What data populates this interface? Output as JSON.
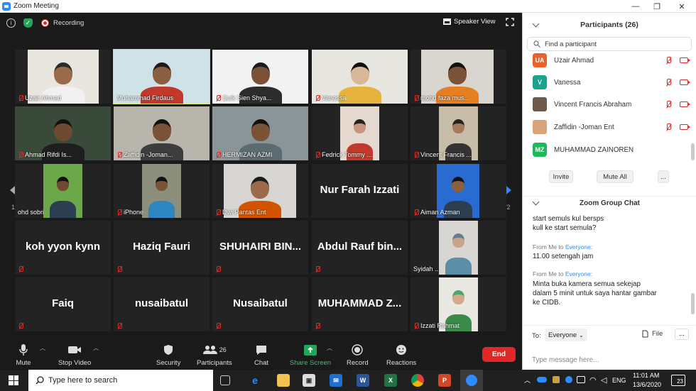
{
  "window": {
    "title": "Zoom Meeting",
    "min": "—",
    "max": "❐",
    "close": "✕"
  },
  "topbar": {
    "recording": "Recording",
    "speaker_view": "Speaker View"
  },
  "colors": {
    "accent": "#2d8cff",
    "end": "#e02828",
    "active_border": "#d6e26a"
  },
  "grid": {
    "page_left": "1/2",
    "page_right": "1/2",
    "tiles": [
      {
        "name": "Uzair Ahmad",
        "muted": true,
        "big": ""
      },
      {
        "name": "Muhammad Firdaus",
        "muted": false,
        "big": ""
      },
      {
        "name": "Quik Sien Shya...",
        "muted": true,
        "big": ""
      },
      {
        "name": "Vanessa",
        "muted": true,
        "big": ""
      },
      {
        "name": "mohd faza mus...",
        "muted": true,
        "big": ""
      },
      {
        "name": "Ahmad Rifdi Is...",
        "muted": true,
        "big": ""
      },
      {
        "name": "Zaffidin -Joman...",
        "muted": true,
        "big": ""
      },
      {
        "name": "HERMIZAN AZMI",
        "muted": true,
        "big": ""
      },
      {
        "name": "Fedrick Tommy ...",
        "muted": true,
        "big": ""
      },
      {
        "name": "Vincent Francis ...",
        "muted": true,
        "big": ""
      },
      {
        "name": "ohd sobri",
        "muted": false,
        "big": ""
      },
      {
        "name": "iPhone",
        "muted": true,
        "big": ""
      },
      {
        "name": "Dwi Pantas Ent",
        "muted": true,
        "big": ""
      },
      {
        "name": "",
        "muted": false,
        "big": "Nur Farah Izzati"
      },
      {
        "name": "Aiman Azman",
        "muted": true,
        "big": ""
      },
      {
        "name": "",
        "muted": true,
        "big": "koh yyon kynn"
      },
      {
        "name": "",
        "muted": true,
        "big": "Haziq Fauri"
      },
      {
        "name": "",
        "muted": true,
        "big": "SHUHAIRI BIN..."
      },
      {
        "name": "",
        "muted": true,
        "big": "Abdul Rauf bin..."
      },
      {
        "name": "Syidah ...",
        "muted": false,
        "big": ""
      },
      {
        "name": "",
        "muted": true,
        "big": "Faiq"
      },
      {
        "name": "",
        "muted": true,
        "big": "nusaibatul"
      },
      {
        "name": "",
        "muted": true,
        "big": "Nusaibatul"
      },
      {
        "name": "",
        "muted": true,
        "big": "MUHAMMAD Z..."
      },
      {
        "name": "Izzati Rahmat",
        "muted": true,
        "big": ""
      }
    ]
  },
  "toolbar": {
    "mute": "Mute",
    "video": "Stop Video",
    "security": "Security",
    "participants": "Participants",
    "participants_count": "26",
    "chat": "Chat",
    "share": "Share Screen",
    "record": "Record",
    "reactions": "Reactions",
    "end": "End"
  },
  "participants": {
    "title": "Participants (26)",
    "search_placeholder": "Find a participant",
    "list": [
      {
        "initials": "UA",
        "name": "Uzair Ahmad",
        "color": "#e8622a"
      },
      {
        "initials": "V",
        "name": "Vanessa",
        "color": "#1aa38c"
      },
      {
        "initials": "",
        "name": "Vincent Francis Abraham",
        "color": "#6d5a4a"
      },
      {
        "initials": "",
        "name": "Zaffidin -Joman Ent",
        "color": "#d9a47a"
      },
      {
        "initials": "MZ",
        "name": "MUHAMMAD ZAINOREN",
        "color": "#1fb85a"
      }
    ],
    "invite": "Invite",
    "mute_all": "Mute All",
    "more": "..."
  },
  "chat": {
    "title": "Zoom Group Chat",
    "msg1": "start semuls kul bersps",
    "msg1b": "kull ke start semula?",
    "meta_prefix": "From Me to ",
    "meta_to": "Everyone",
    "msg2": "11.00 setengah jam",
    "msg3a": "Minta buka kamera semua sekejap",
    "msg3b": "dalam 5 minit untuk saya hantar gambar",
    "msg3c": "ke CIDB.",
    "to_label": "To:",
    "to_value": "Everyone",
    "file": "File",
    "more": "...",
    "placeholder": "Type message here..."
  },
  "taskbar": {
    "search": "Type here to search",
    "time": "11:01 AM",
    "date": "13/6/2020",
    "lang": "ENG",
    "notif": "23"
  }
}
